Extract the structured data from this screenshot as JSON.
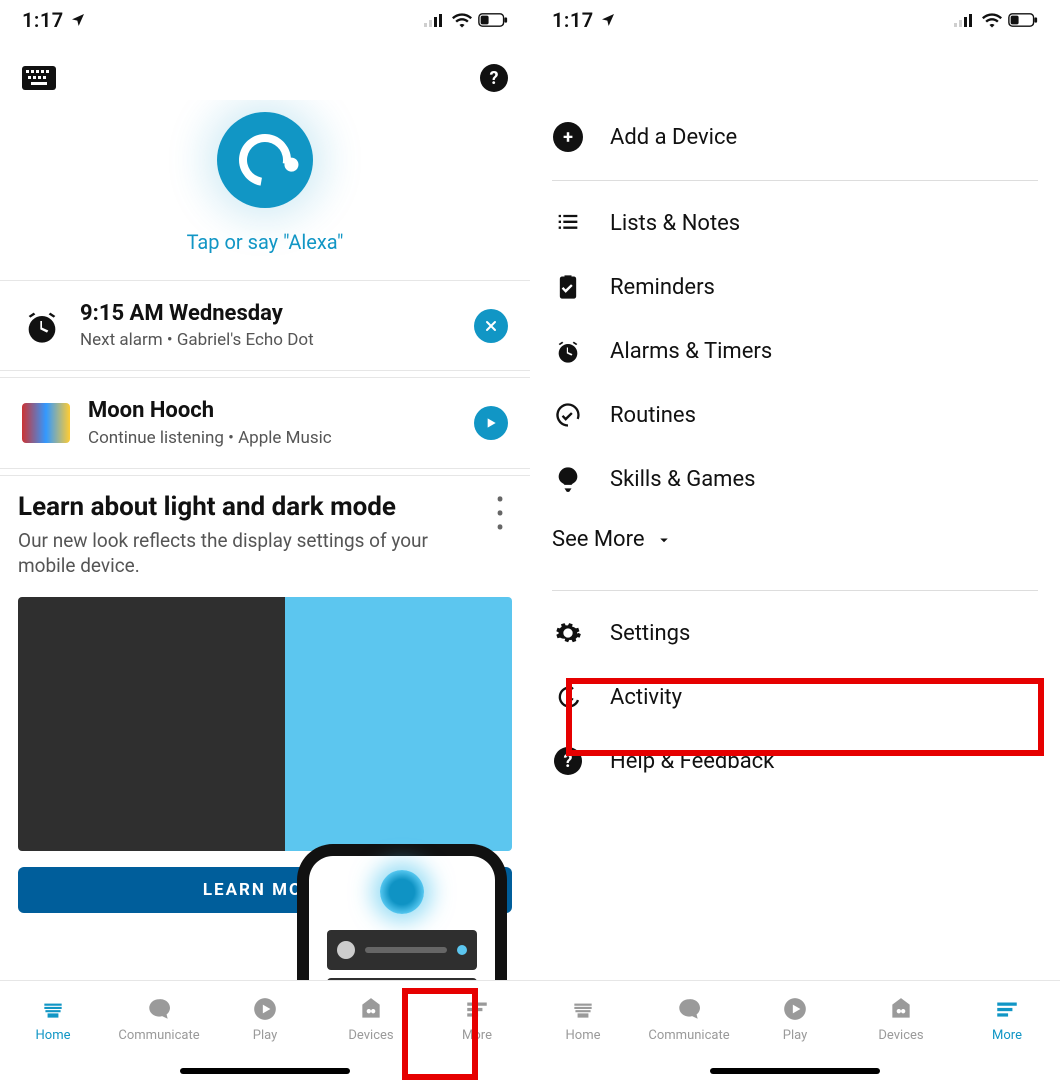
{
  "status": {
    "time": "1:17"
  },
  "left": {
    "hero_text": "Tap or say \"Alexa\"",
    "alarm": {
      "title": "9:15 AM Wednesday",
      "subtitle": "Next alarm • Gabriel's Echo Dot"
    },
    "music": {
      "title": "Moon Hooch",
      "subtitle": "Continue listening • Apple Music"
    },
    "learn": {
      "title": "Learn about light and dark mode",
      "body": "Our new look reflects the display settings of your mobile device.",
      "button": "LEARN MORE"
    }
  },
  "right": {
    "menu": {
      "add_device": "Add a Device",
      "lists_notes": "Lists & Notes",
      "reminders": "Reminders",
      "alarms_timers": "Alarms & Timers",
      "routines": "Routines",
      "skills_games": "Skills & Games",
      "see_more": "See More",
      "settings": "Settings",
      "activity": "Activity",
      "help_feedback": "Help & Feedback"
    }
  },
  "tabs": {
    "home": "Home",
    "communicate": "Communicate",
    "play": "Play",
    "devices": "Devices",
    "more": "More"
  }
}
